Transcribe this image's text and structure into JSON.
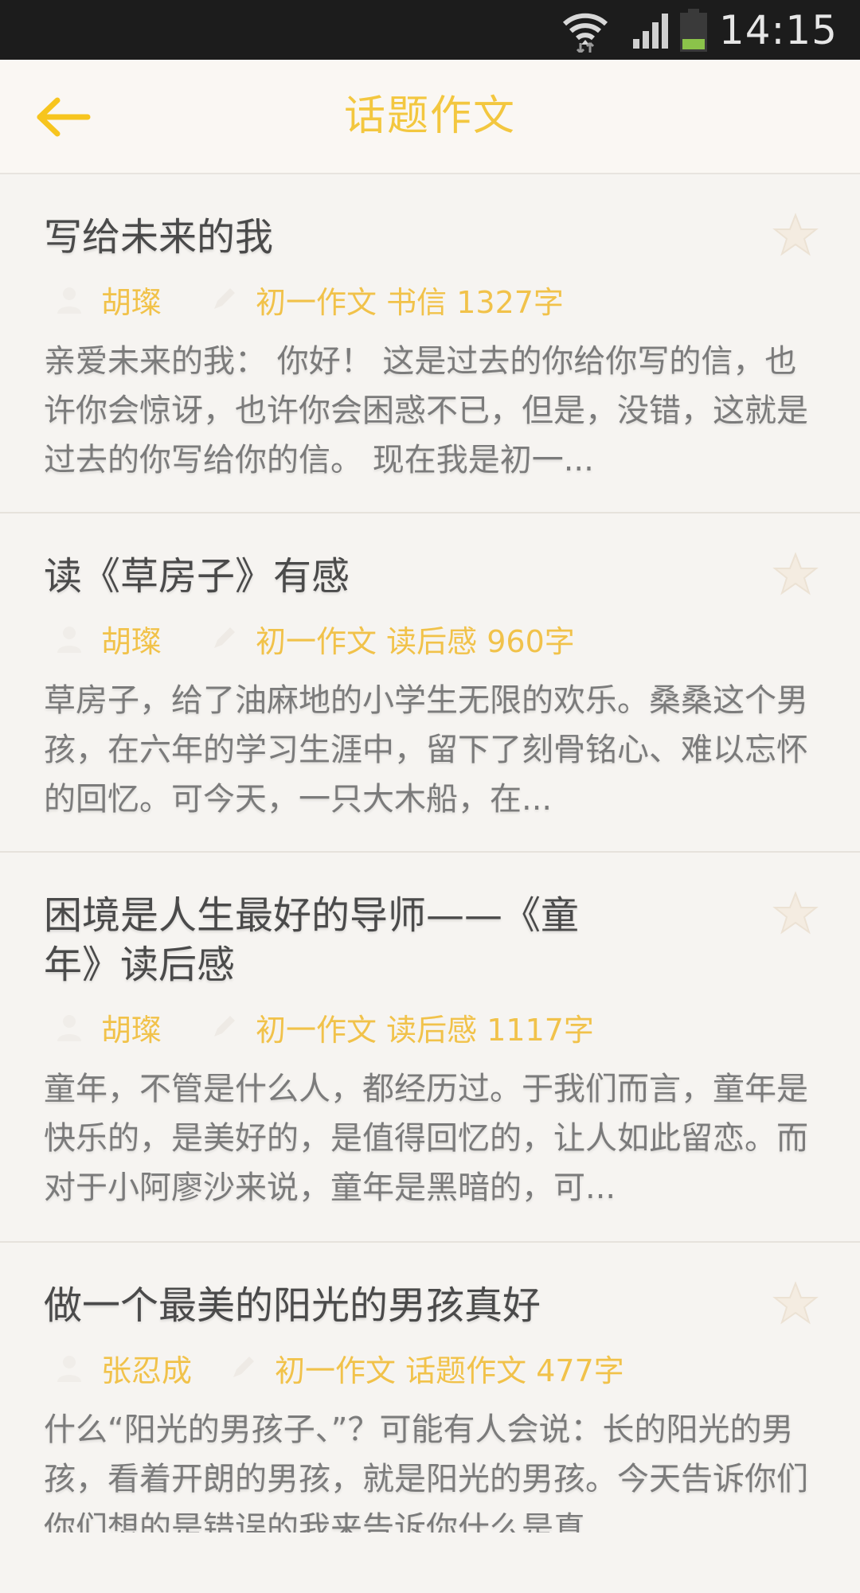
{
  "status_bar": {
    "time": "14:15"
  },
  "header": {
    "title": "话题作文"
  },
  "essays": [
    {
      "title": "写给未来的我",
      "author": "胡璨",
      "grade": "初一作文",
      "category": "书信",
      "word_count": "1327字",
      "summary": "亲爱未来的我： 你好！ 这是过去的你给你写的信，也许你会惊讶，也许你会困惑不已，但是，没错，这就是过去的你写给你的信。 现在我是初一..."
    },
    {
      "title": "读《草房子》有感",
      "author": "胡璨",
      "grade": "初一作文",
      "category": "读后感",
      "word_count": "960字",
      "summary": "草房子，给了油麻地的小学生无限的欢乐。桑桑这个男孩，在六年的学习生涯中，留下了刻骨铭心、难以忘怀的回忆。可今天，一只大木船，在..."
    },
    {
      "title": "困境是人生最好的导师——《童年》读后感",
      "author": "胡璨",
      "grade": "初一作文",
      "category": "读后感",
      "word_count": "1117字",
      "summary": "童年，不管是什么人，都经历过。于我们而言，童年是快乐的，是美好的，是值得回忆的，让人如此留恋。而对于小阿廖沙来说，童年是黑暗的，可..."
    },
    {
      "title": "做一个最美的阳光的男孩真好",
      "author": "张忍成",
      "grade": "初一作文",
      "category": "话题作文",
      "word_count": "477字",
      "summary": "什么“阳光的男孩子、”？可能有人会说：长的阳光的男孩，看着开朗的男孩，就是阳光的男孩。今天告诉你们你们想的是错误的我来告诉你什么是真"
    }
  ],
  "colors": {
    "accent": "#f3c73f",
    "title_text": "#4a4a4a",
    "summary_text": "#7b7b7b",
    "status_bar": "#1c1c1c",
    "battery_fill": "#8bc34a"
  },
  "icons": {
    "back": "arrow-left-icon",
    "favorite": "star-icon",
    "author": "person-icon",
    "category": "pencil-icon",
    "wifi": "wifi-icon",
    "signal": "signal-icon",
    "battery": "battery-icon"
  }
}
